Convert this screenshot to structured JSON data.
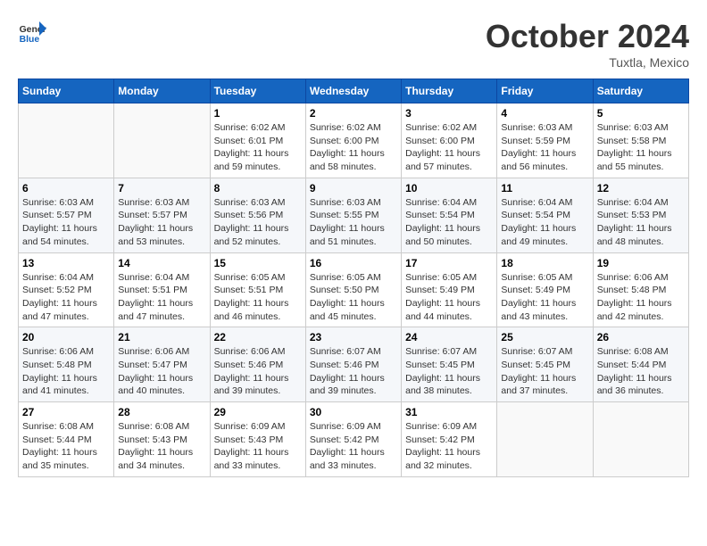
{
  "header": {
    "logo_general": "General",
    "logo_blue": "Blue",
    "month_title": "October 2024",
    "location": "Tuxtla, Mexico"
  },
  "calendar": {
    "weekdays": [
      "Sunday",
      "Monday",
      "Tuesday",
      "Wednesday",
      "Thursday",
      "Friday",
      "Saturday"
    ],
    "weeks": [
      [
        {
          "day": "",
          "sunrise": "",
          "sunset": "",
          "daylight": ""
        },
        {
          "day": "",
          "sunrise": "",
          "sunset": "",
          "daylight": ""
        },
        {
          "day": "1",
          "sunrise": "Sunrise: 6:02 AM",
          "sunset": "Sunset: 6:01 PM",
          "daylight": "Daylight: 11 hours and 59 minutes."
        },
        {
          "day": "2",
          "sunrise": "Sunrise: 6:02 AM",
          "sunset": "Sunset: 6:00 PM",
          "daylight": "Daylight: 11 hours and 58 minutes."
        },
        {
          "day": "3",
          "sunrise": "Sunrise: 6:02 AM",
          "sunset": "Sunset: 6:00 PM",
          "daylight": "Daylight: 11 hours and 57 minutes."
        },
        {
          "day": "4",
          "sunrise": "Sunrise: 6:03 AM",
          "sunset": "Sunset: 5:59 PM",
          "daylight": "Daylight: 11 hours and 56 minutes."
        },
        {
          "day": "5",
          "sunrise": "Sunrise: 6:03 AM",
          "sunset": "Sunset: 5:58 PM",
          "daylight": "Daylight: 11 hours and 55 minutes."
        }
      ],
      [
        {
          "day": "6",
          "sunrise": "Sunrise: 6:03 AM",
          "sunset": "Sunset: 5:57 PM",
          "daylight": "Daylight: 11 hours and 54 minutes."
        },
        {
          "day": "7",
          "sunrise": "Sunrise: 6:03 AM",
          "sunset": "Sunset: 5:57 PM",
          "daylight": "Daylight: 11 hours and 53 minutes."
        },
        {
          "day": "8",
          "sunrise": "Sunrise: 6:03 AM",
          "sunset": "Sunset: 5:56 PM",
          "daylight": "Daylight: 11 hours and 52 minutes."
        },
        {
          "day": "9",
          "sunrise": "Sunrise: 6:03 AM",
          "sunset": "Sunset: 5:55 PM",
          "daylight": "Daylight: 11 hours and 51 minutes."
        },
        {
          "day": "10",
          "sunrise": "Sunrise: 6:04 AM",
          "sunset": "Sunset: 5:54 PM",
          "daylight": "Daylight: 11 hours and 50 minutes."
        },
        {
          "day": "11",
          "sunrise": "Sunrise: 6:04 AM",
          "sunset": "Sunset: 5:54 PM",
          "daylight": "Daylight: 11 hours and 49 minutes."
        },
        {
          "day": "12",
          "sunrise": "Sunrise: 6:04 AM",
          "sunset": "Sunset: 5:53 PM",
          "daylight": "Daylight: 11 hours and 48 minutes."
        }
      ],
      [
        {
          "day": "13",
          "sunrise": "Sunrise: 6:04 AM",
          "sunset": "Sunset: 5:52 PM",
          "daylight": "Daylight: 11 hours and 47 minutes."
        },
        {
          "day": "14",
          "sunrise": "Sunrise: 6:04 AM",
          "sunset": "Sunset: 5:51 PM",
          "daylight": "Daylight: 11 hours and 47 minutes."
        },
        {
          "day": "15",
          "sunrise": "Sunrise: 6:05 AM",
          "sunset": "Sunset: 5:51 PM",
          "daylight": "Daylight: 11 hours and 46 minutes."
        },
        {
          "day": "16",
          "sunrise": "Sunrise: 6:05 AM",
          "sunset": "Sunset: 5:50 PM",
          "daylight": "Daylight: 11 hours and 45 minutes."
        },
        {
          "day": "17",
          "sunrise": "Sunrise: 6:05 AM",
          "sunset": "Sunset: 5:49 PM",
          "daylight": "Daylight: 11 hours and 44 minutes."
        },
        {
          "day": "18",
          "sunrise": "Sunrise: 6:05 AM",
          "sunset": "Sunset: 5:49 PM",
          "daylight": "Daylight: 11 hours and 43 minutes."
        },
        {
          "day": "19",
          "sunrise": "Sunrise: 6:06 AM",
          "sunset": "Sunset: 5:48 PM",
          "daylight": "Daylight: 11 hours and 42 minutes."
        }
      ],
      [
        {
          "day": "20",
          "sunrise": "Sunrise: 6:06 AM",
          "sunset": "Sunset: 5:48 PM",
          "daylight": "Daylight: 11 hours and 41 minutes."
        },
        {
          "day": "21",
          "sunrise": "Sunrise: 6:06 AM",
          "sunset": "Sunset: 5:47 PM",
          "daylight": "Daylight: 11 hours and 40 minutes."
        },
        {
          "day": "22",
          "sunrise": "Sunrise: 6:06 AM",
          "sunset": "Sunset: 5:46 PM",
          "daylight": "Daylight: 11 hours and 39 minutes."
        },
        {
          "day": "23",
          "sunrise": "Sunrise: 6:07 AM",
          "sunset": "Sunset: 5:46 PM",
          "daylight": "Daylight: 11 hours and 39 minutes."
        },
        {
          "day": "24",
          "sunrise": "Sunrise: 6:07 AM",
          "sunset": "Sunset: 5:45 PM",
          "daylight": "Daylight: 11 hours and 38 minutes."
        },
        {
          "day": "25",
          "sunrise": "Sunrise: 6:07 AM",
          "sunset": "Sunset: 5:45 PM",
          "daylight": "Daylight: 11 hours and 37 minutes."
        },
        {
          "day": "26",
          "sunrise": "Sunrise: 6:08 AM",
          "sunset": "Sunset: 5:44 PM",
          "daylight": "Daylight: 11 hours and 36 minutes."
        }
      ],
      [
        {
          "day": "27",
          "sunrise": "Sunrise: 6:08 AM",
          "sunset": "Sunset: 5:44 PM",
          "daylight": "Daylight: 11 hours and 35 minutes."
        },
        {
          "day": "28",
          "sunrise": "Sunrise: 6:08 AM",
          "sunset": "Sunset: 5:43 PM",
          "daylight": "Daylight: 11 hours and 34 minutes."
        },
        {
          "day": "29",
          "sunrise": "Sunrise: 6:09 AM",
          "sunset": "Sunset: 5:43 PM",
          "daylight": "Daylight: 11 hours and 33 minutes."
        },
        {
          "day": "30",
          "sunrise": "Sunrise: 6:09 AM",
          "sunset": "Sunset: 5:42 PM",
          "daylight": "Daylight: 11 hours and 33 minutes."
        },
        {
          "day": "31",
          "sunrise": "Sunrise: 6:09 AM",
          "sunset": "Sunset: 5:42 PM",
          "daylight": "Daylight: 11 hours and 32 minutes."
        },
        {
          "day": "",
          "sunrise": "",
          "sunset": "",
          "daylight": ""
        },
        {
          "day": "",
          "sunrise": "",
          "sunset": "",
          "daylight": ""
        }
      ]
    ]
  }
}
